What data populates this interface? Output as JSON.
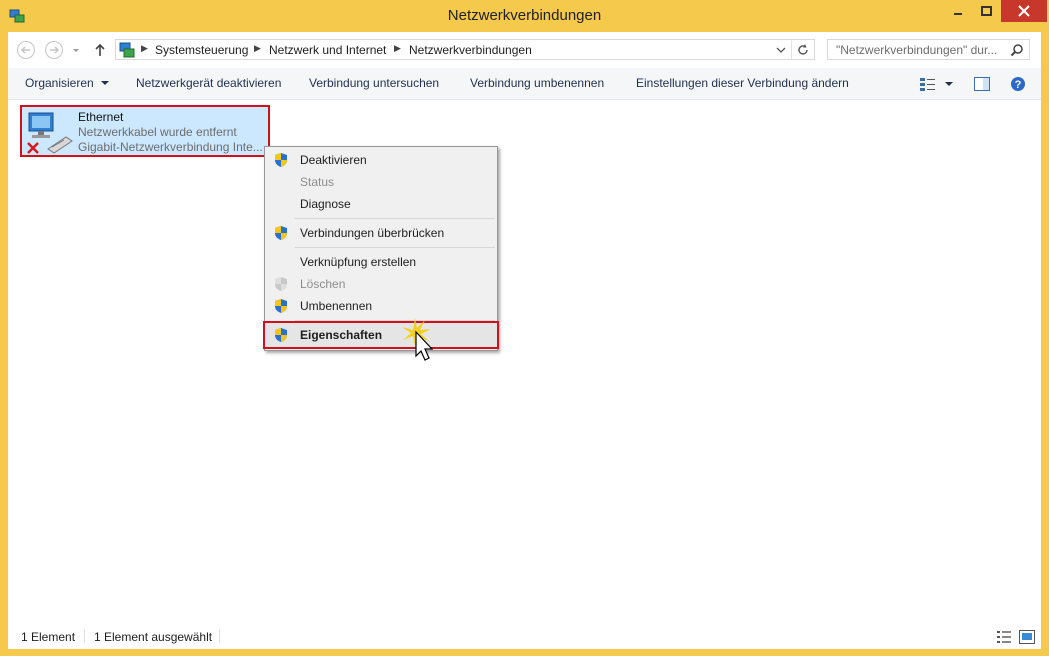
{
  "window": {
    "title": "Netzwerkverbindungen",
    "minimize_glyph": "▬",
    "maximize_glyph": "▢",
    "close_glyph": "✕"
  },
  "nav": {
    "back_icon": "back-arrow-icon",
    "forward_icon": "forward-arrow-icon",
    "recent_icon": "chevron-down-icon",
    "up_icon": "up-arrow-icon",
    "breadcrumbs": [
      "Systemsteuerung",
      "Netzwerk und Internet",
      "Netzwerkverbindungen"
    ],
    "search_placeholder": "\"Netzwerkverbindungen\" dur..."
  },
  "commands": {
    "organize": "Organisieren",
    "disable_device": "Netzwerkgerät deaktivieren",
    "diagnose": "Verbindung untersuchen",
    "rename": "Verbindung umbenennen",
    "change_settings": "Einstellungen dieser Verbindung ändern"
  },
  "item": {
    "name": "Ethernet",
    "status": "Netzwerkkabel wurde entfernt",
    "adapter": "Gigabit-Netzwerkverbindung Inte..."
  },
  "context_menu": {
    "items": [
      {
        "label": "Deaktivieren",
        "shield": true,
        "enabled": true
      },
      {
        "label": "Status",
        "shield": false,
        "enabled": false
      },
      {
        "label": "Diagnose",
        "shield": false,
        "enabled": true
      },
      {
        "label": "Verbindungen überbrücken",
        "shield": true,
        "enabled": true
      },
      {
        "label": "Verknüpfung erstellen",
        "shield": false,
        "enabled": true
      },
      {
        "label": "Löschen",
        "shield": true,
        "enabled": false
      },
      {
        "label": "Umbenennen",
        "shield": true,
        "enabled": true
      },
      {
        "label": "Eigenschaften",
        "shield": true,
        "enabled": true,
        "highlighted": true
      }
    ]
  },
  "statusbar": {
    "count": "1 Element",
    "selected": "1 Element ausgewählt"
  },
  "colors": {
    "title_bar": "#f5c94c",
    "close_button": "#c7372c",
    "selection": "#cce8ff",
    "highlight_border": "#d0111b"
  }
}
